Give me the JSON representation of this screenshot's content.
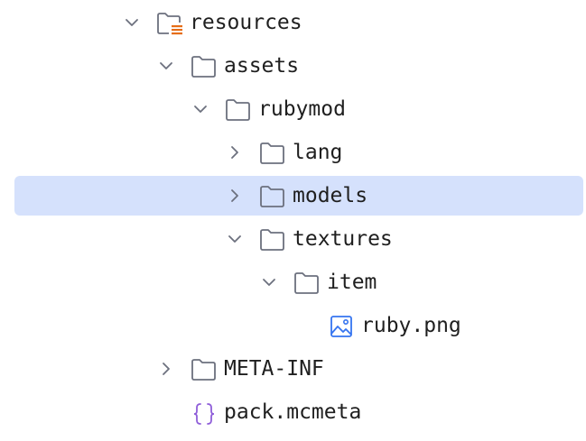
{
  "tree": {
    "items": [
      {
        "label": "resources",
        "expanded": true,
        "icon": "resources-folder-icon"
      },
      {
        "label": "assets",
        "expanded": true,
        "icon": "folder-icon"
      },
      {
        "label": "rubymod",
        "expanded": true,
        "icon": "folder-icon"
      },
      {
        "label": "lang",
        "expanded": false,
        "icon": "folder-icon"
      },
      {
        "label": "models",
        "expanded": false,
        "icon": "folder-icon",
        "selected": true
      },
      {
        "label": "textures",
        "expanded": true,
        "icon": "folder-icon"
      },
      {
        "label": "item",
        "expanded": true,
        "icon": "folder-icon"
      },
      {
        "label": "ruby.png",
        "icon": "image-file-icon"
      },
      {
        "label": "META-INF",
        "expanded": false,
        "icon": "folder-icon"
      },
      {
        "label": "pack.mcmeta",
        "icon": "json-file-icon"
      }
    ]
  },
  "colors": {
    "selection": "#d5e1fc",
    "folder_stroke": "#6c707e",
    "resource_badge": "#e66d17",
    "image_icon": "#3574f0",
    "json_icon": "#8f5ed9"
  }
}
